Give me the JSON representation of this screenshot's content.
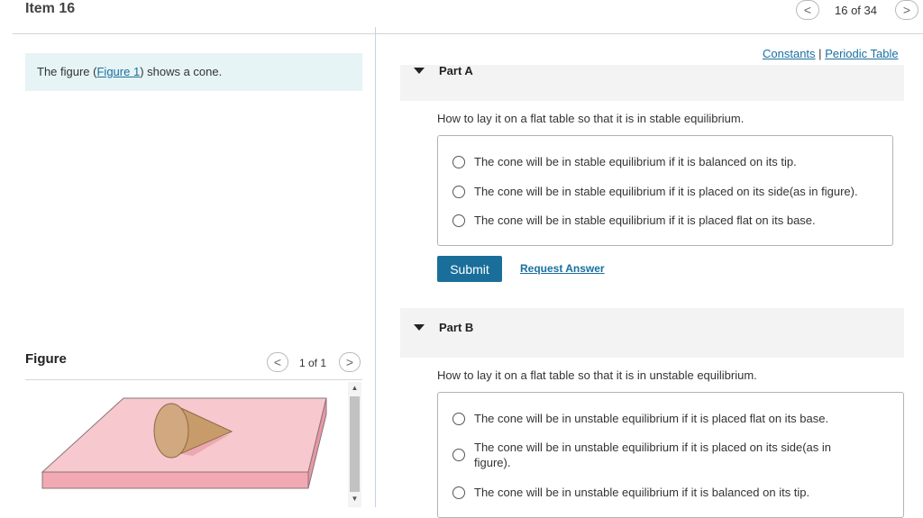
{
  "header": {
    "item_title": "Item 16",
    "counter": "16 of 34",
    "prev_icon": "<",
    "next_icon": ">"
  },
  "left": {
    "intro_prefix": "The figure (",
    "intro_link": "Figure 1",
    "intro_suffix": ") shows a cone.",
    "figure_label": "Figure",
    "figure_counter": "1 of 1",
    "figure_prev_icon": "<",
    "figure_next_icon": ">"
  },
  "links": {
    "constants": "Constants",
    "separator": "|",
    "periodic_table": "Periodic Table"
  },
  "part_a": {
    "title": "Part A",
    "question": "How to lay it on a flat table so that it is in stable equilibrium.",
    "options": [
      "The cone will be in stable equilibrium if it is balanced on its tip.",
      "The cone will be in stable equilibrium if it is placed on its side(as in figure).",
      "The cone will be in stable equilibrium if it is placed flat on its base."
    ],
    "submit_label": "Submit",
    "request_answer_label": "Request Answer"
  },
  "part_b": {
    "title": "Part B",
    "question": "How to lay it on a flat table so that it is in unstable equilibrium.",
    "options": [
      "The cone will be in unstable equilibrium if it is placed flat on its base.",
      "The cone will be in unstable equilibrium if it is placed on its side(as in figure).",
      "The cone will be in unstable equilibrium if it is balanced on its tip."
    ]
  },
  "colors": {
    "accent": "#1a6f9a",
    "intro_bg": "#e6f4f6",
    "table_top": "#f7c8ce",
    "cone": "#c79a6a"
  },
  "icons": {
    "part_toggle": "caret-down-icon",
    "scroll_up": "triangle-up-icon",
    "scroll_down": "triangle-down-icon"
  }
}
